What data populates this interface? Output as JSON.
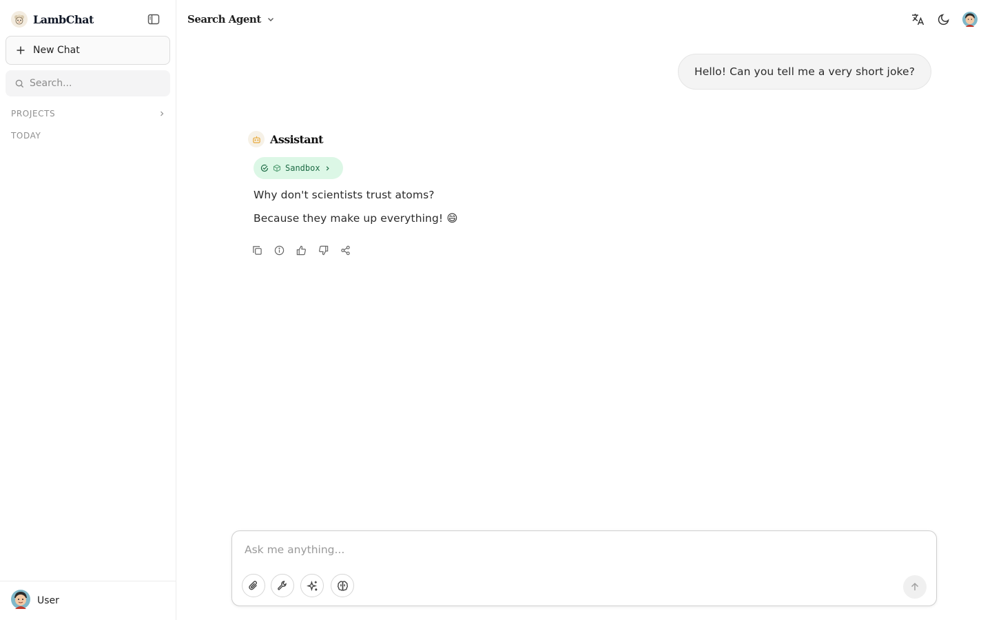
{
  "sidebar": {
    "app_name": "LambChat",
    "new_chat_label": "New Chat",
    "search_placeholder": "Search...",
    "sections": {
      "projects_label": "PROJECTS",
      "today_label": "TODAY"
    },
    "user": {
      "name": "User"
    }
  },
  "header": {
    "agent_name": "Search Agent",
    "icons": [
      "translate-icon",
      "moon-icon",
      "avatar"
    ]
  },
  "conversation": {
    "user_message": "Hello! Can you tell me a very short joke?",
    "assistant": {
      "name": "Assistant",
      "tool_badge": "Sandbox",
      "lines": [
        "Why don't scientists trust atoms?",
        "Because they make up everything! 😄"
      ],
      "actions": [
        "copy-icon",
        "info-icon",
        "thumbs-up-icon",
        "thumbs-down-icon",
        "share-icon"
      ]
    }
  },
  "composer": {
    "placeholder": "Ask me anything...",
    "tools": [
      "attach-icon",
      "wrench-icon",
      "sparkles-icon",
      "brain-icon"
    ]
  },
  "colors": {
    "sandbox_bg": "#dcf7e6",
    "sandbox_text": "#1d6b45",
    "bubble_bg": "#f4f4f4",
    "bot_accent": "#e8a93a"
  }
}
